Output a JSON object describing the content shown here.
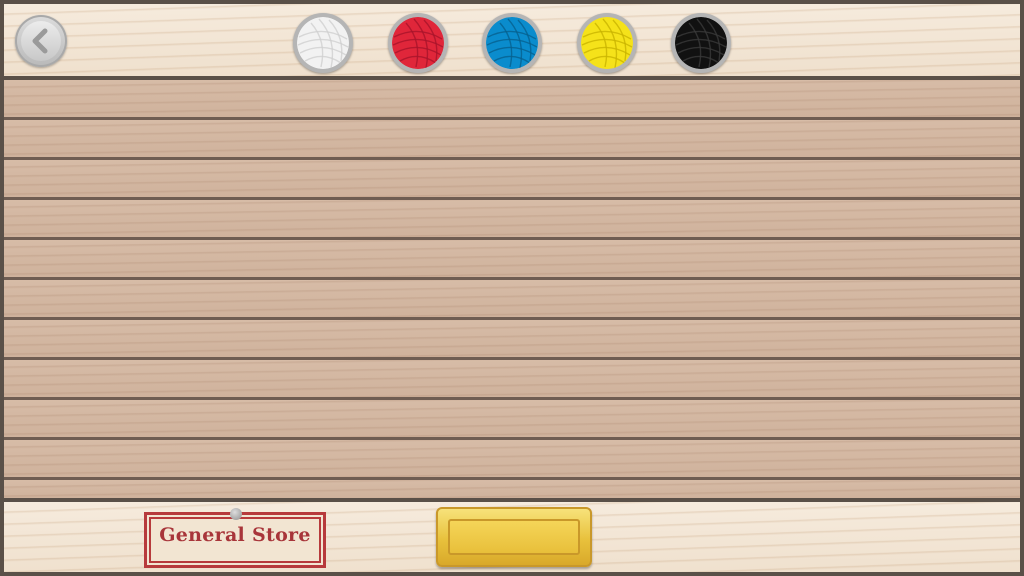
{
  "toolbar": {
    "back_icon": "chevron-left-icon",
    "yarn_colors": [
      {
        "name": "white",
        "color": "#f2f2f2",
        "thread": "#d0d0d0"
      },
      {
        "name": "red",
        "color": "#e0263a",
        "thread": "#a8142a"
      },
      {
        "name": "blue",
        "color": "#0a8ccd",
        "thread": "#06608f"
      },
      {
        "name": "yellow",
        "color": "#f5e21a",
        "thread": "#c9b400"
      },
      {
        "name": "black",
        "color": "#111111",
        "thread": "#3a3a3a"
      }
    ]
  },
  "footer": {
    "store_label": "General Store",
    "gold_button_label": ""
  }
}
